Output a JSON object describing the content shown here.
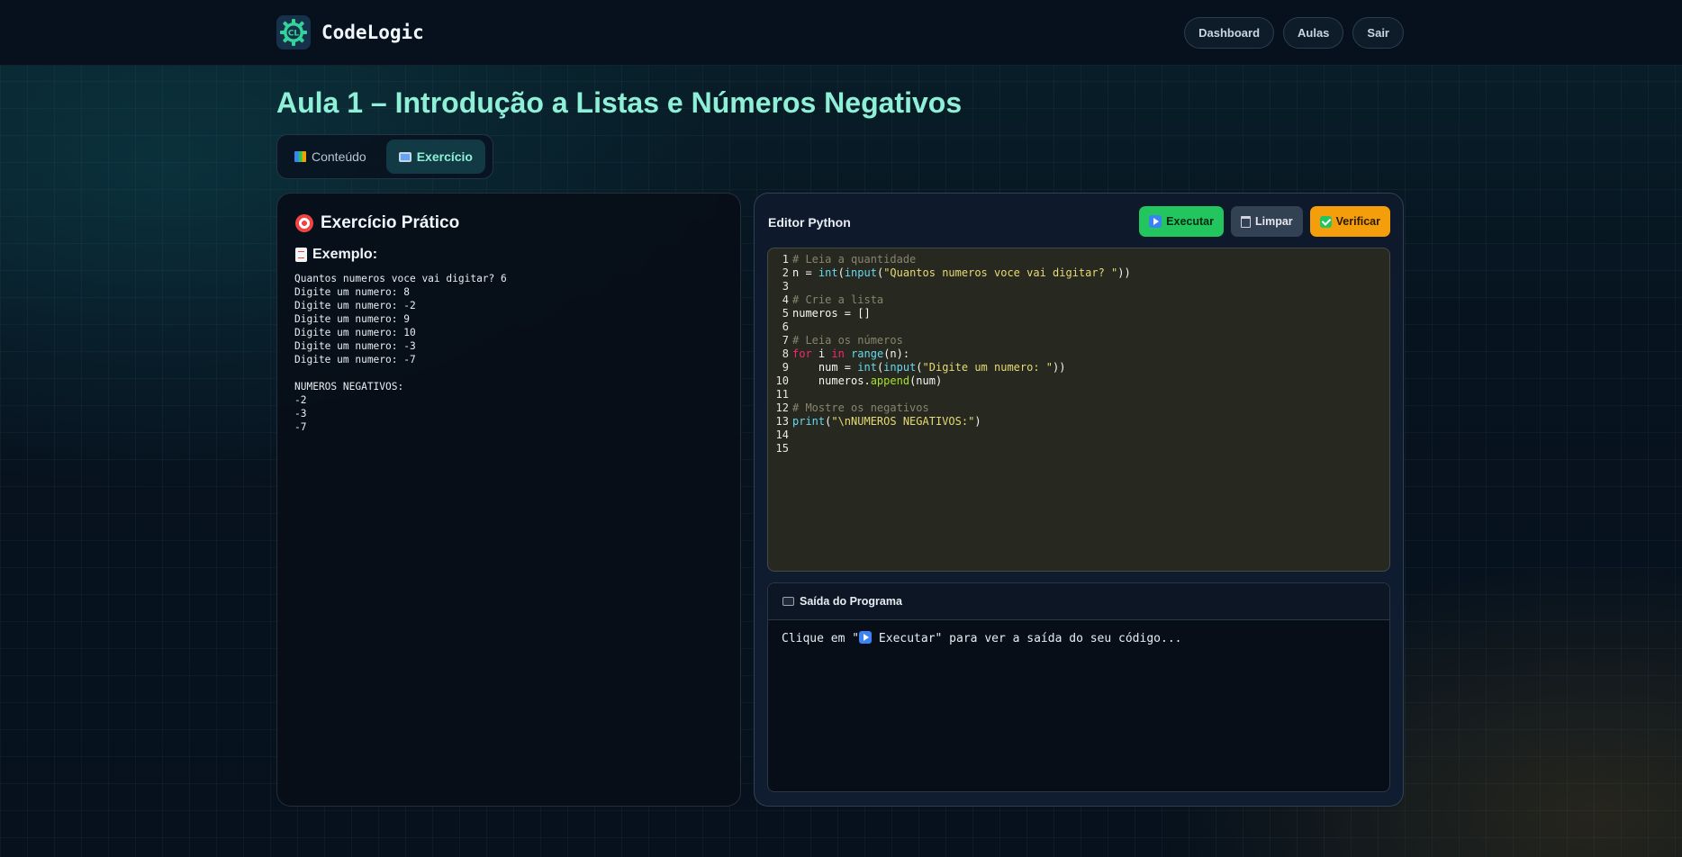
{
  "header": {
    "brand_name": "CodeLogic",
    "logo_text": "CL",
    "nav": [
      "Dashboard",
      "Aulas",
      "Sair"
    ]
  },
  "page": {
    "title": "Aula 1 – Introdução a Listas e Números Negativos"
  },
  "tabs": [
    {
      "label": "Conteúdo",
      "icon": "books-icon",
      "active": false
    },
    {
      "label": "Exercício",
      "icon": "laptop-icon",
      "active": true
    }
  ],
  "exercise": {
    "title": "Exercício Prático",
    "title_icon": "target-icon",
    "example_title": "Exemplo:",
    "example_icon": "document-icon",
    "example_output": "Quantos numeros voce vai digitar? 6\nDigite um numero: 8\nDigite um numero: -2\nDigite um numero: 9\nDigite um numero: 10\nDigite um numero: -3\nDigite um numero: -7\n\nNUMEROS NEGATIVOS:\n-2\n-3\n-7"
  },
  "editor": {
    "title": "Editor Python",
    "buttons": {
      "run": "Executar",
      "clear": "Limpar",
      "verify": "Verificar"
    },
    "line_numbers": [
      "1",
      "2",
      "3",
      "4",
      "5",
      "6",
      "7",
      "8",
      "9",
      "10",
      "11",
      "12",
      "13",
      "14",
      "15"
    ],
    "code_lines": [
      "# Leia a quantidade",
      "n = int(input(\"Quantos numeros voce vai digitar? \"))",
      "",
      "# Crie a lista",
      "numeros = []",
      "",
      "# Leia os números",
      "for i in range(n):",
      "    num = int(input(\"Digite um numero: \"))",
      "    numeros.append(num)",
      "",
      "# Mostre os negativos",
      "print(\"\\nNUMEROS NEGATIVOS:\")",
      "",
      ""
    ]
  },
  "output": {
    "title": "Saída do Programa",
    "title_icon": "terminal-icon",
    "placeholder_before": "Clique em \"",
    "placeholder_run": " Executar\" para ver a saída do seu código..."
  },
  "colors": {
    "accent": "#8ff0d8",
    "run": "#22c55e",
    "clear": "#334155",
    "verify": "#f59e0b",
    "editor_bg": "#27281f"
  }
}
